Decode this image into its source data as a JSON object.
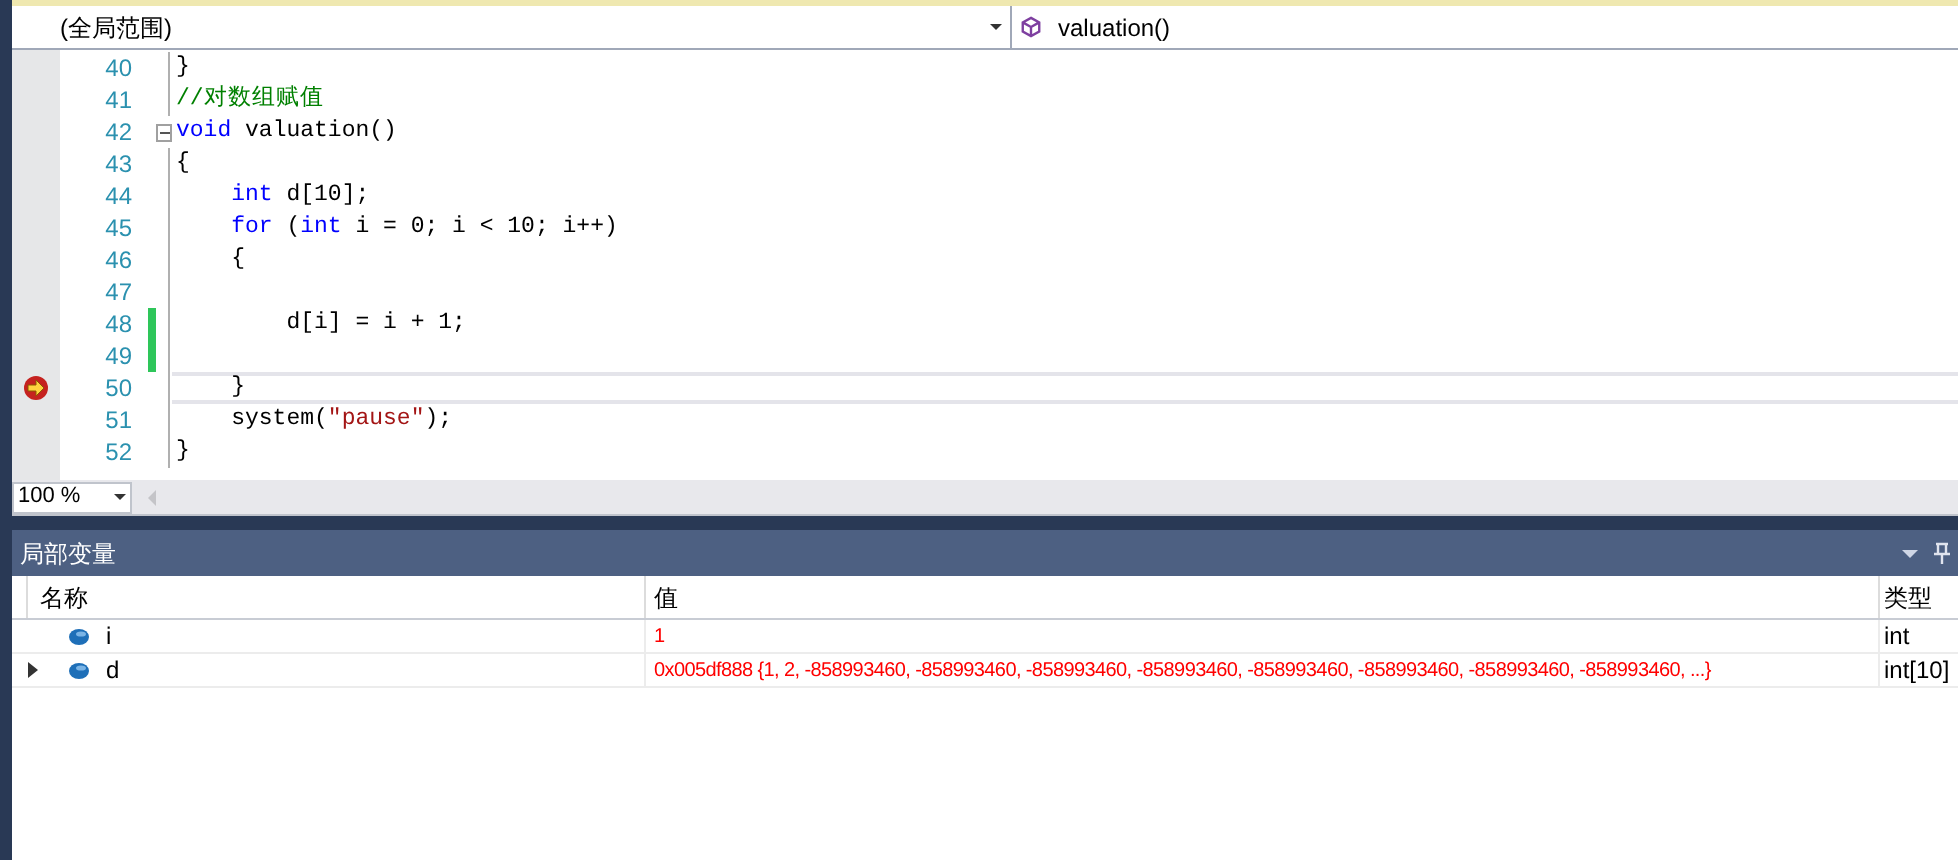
{
  "nav_bar": {
    "scope": "(全局范围)",
    "member": "valuation()"
  },
  "editor": {
    "lines": [
      {
        "number": "40",
        "tokens": [
          {
            "kind": "plain",
            "text": "}"
          }
        ]
      },
      {
        "number": "41",
        "tokens": [
          {
            "kind": "comment",
            "text": "//对数组赋值"
          }
        ]
      },
      {
        "number": "42",
        "foldable": true,
        "tokens": [
          {
            "kind": "keyword",
            "text": "void"
          },
          {
            "kind": "plain",
            "text": " valuation()"
          }
        ]
      },
      {
        "number": "43",
        "tokens": [
          {
            "kind": "plain",
            "text": "{"
          }
        ]
      },
      {
        "number": "44",
        "tokens": [
          {
            "kind": "keyword",
            "text": "    int"
          },
          {
            "kind": "plain",
            "text": " d[10];"
          }
        ]
      },
      {
        "number": "45",
        "tokens": [
          {
            "kind": "keyword",
            "text": "    for"
          },
          {
            "kind": "plain",
            "text": " ("
          },
          {
            "kind": "keyword",
            "text": "int"
          },
          {
            "kind": "plain",
            "text": " i = 0; i < 10; i++)"
          }
        ]
      },
      {
        "number": "46",
        "tokens": [
          {
            "kind": "plain",
            "text": "    {"
          }
        ]
      },
      {
        "number": "47"
      },
      {
        "number": "48",
        "changed": true,
        "tokens": [
          {
            "kind": "plain",
            "text": "        d[i] = i + 1;"
          }
        ]
      },
      {
        "number": "49",
        "changed": true
      },
      {
        "number": "50",
        "current": true,
        "tokens": [
          {
            "kind": "plain",
            "text": "    }"
          }
        ]
      },
      {
        "number": "51",
        "tokens": [
          {
            "kind": "plain",
            "text": "    system("
          },
          {
            "kind": "string",
            "text": "\"pause\""
          },
          {
            "kind": "plain",
            "text": ");"
          }
        ]
      },
      {
        "number": "52",
        "tokens": [
          {
            "kind": "plain",
            "text": "}"
          }
        ]
      }
    ],
    "zoom": "100 %"
  },
  "locals_panel": {
    "title": "局部变量",
    "columns": [
      "名称",
      "值",
      "类型"
    ],
    "rows": [
      {
        "name": "i",
        "value": "1",
        "type": "int",
        "expandable": false
      },
      {
        "name": "d",
        "value": "0x005df888 {1, 2, -858993460, -858993460, -858993460, -858993460, -858993460, -858993460, -858993460, -858993460, ...}",
        "type": "int[10]",
        "expandable": true
      }
    ]
  }
}
